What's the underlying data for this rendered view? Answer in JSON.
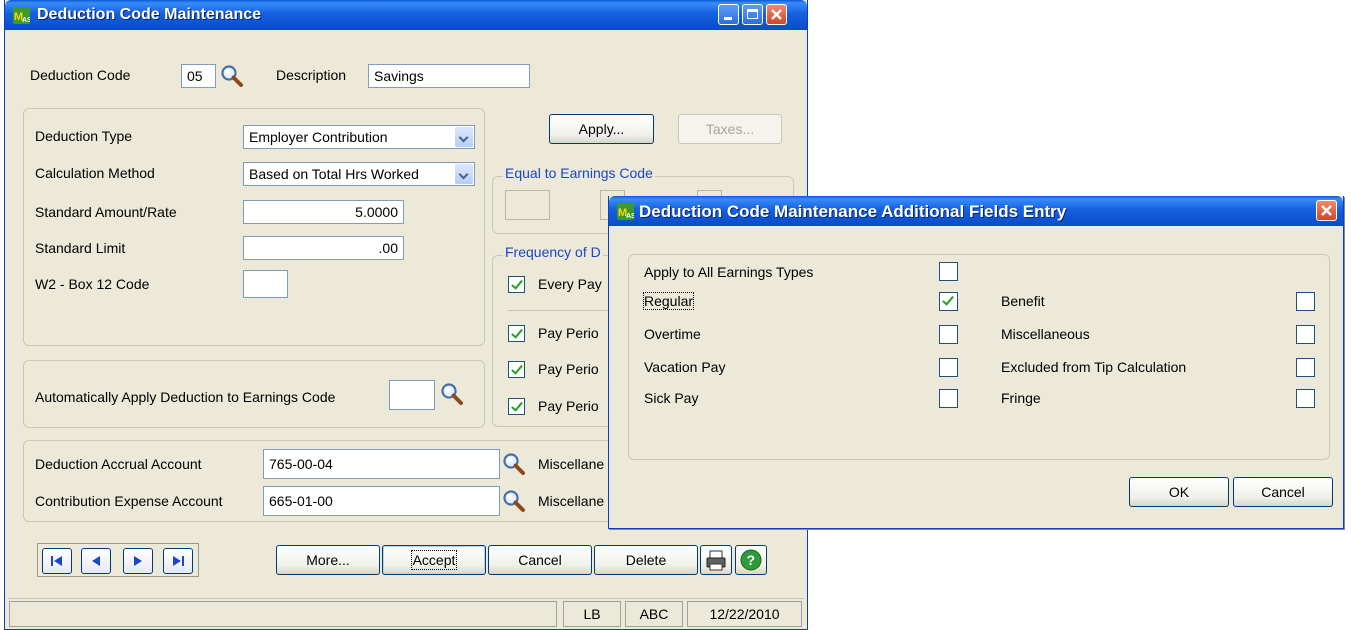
{
  "main": {
    "title": "Deduction Code Maintenance",
    "deduction_code_label": "Deduction Code",
    "deduction_code_value": "05",
    "description_label": "Description",
    "description_value": "Savings",
    "deduction_type_label": "Deduction Type",
    "deduction_type_value": "Employer Contribution",
    "calc_method_label": "Calculation Method",
    "calc_method_value": "Based on Total Hrs Worked",
    "std_amount_label": "Standard Amount/Rate",
    "std_amount_value": "5.0000",
    "std_limit_label": "Standard Limit",
    "std_limit_value": ".00",
    "w2_label": "W2 - Box 12 Code",
    "w2_value": "",
    "apply_label": "Apply...",
    "taxes_label": "Taxes...",
    "equal_group": "Equal to Earnings Code",
    "freq_group": "Frequency of D",
    "every_pay_label": "Every Pay",
    "pay_period_label": "Pay Perio",
    "auto_apply_label": "Automatically Apply Deduction to Earnings Code",
    "accrual_label": "Deduction Accrual Account",
    "accrual_value": "765-00-04",
    "contrib_label": "Contribution Expense Account",
    "contrib_value": "665-01-00",
    "misc_label": "Miscellane",
    "more_label": "More...",
    "accept_label": "Accept",
    "cancel_label": "Cancel",
    "delete_label": "Delete",
    "status": {
      "user": "LB",
      "company": "ABC",
      "date": "12/22/2010"
    },
    "checks": {
      "every_pay": true,
      "pay_period_1": true,
      "pay_period_2": true,
      "pay_period_3": true
    }
  },
  "dialog": {
    "title": "Deduction Code Maintenance Additional Fields Entry",
    "apply_all_label": "Apply to All Earnings Types",
    "left_items": [
      {
        "label": "Regular",
        "checked": true
      },
      {
        "label": "Overtime",
        "checked": false
      },
      {
        "label": "Vacation Pay",
        "checked": false
      },
      {
        "label": "Sick Pay",
        "checked": false
      }
    ],
    "right_items": [
      {
        "label": "Benefit",
        "checked": false
      },
      {
        "label": "Miscellaneous",
        "checked": false
      },
      {
        "label": "Excluded from Tip Calculation",
        "checked": false
      },
      {
        "label": "Fringe",
        "checked": false
      }
    ],
    "ok_label": "OK",
    "cancel_label": "Cancel"
  },
  "icons": [
    "app-icon",
    "magnifier-icon",
    "minimize-icon",
    "maximize-icon",
    "close-icon",
    "first-record-icon",
    "previous-record-icon",
    "next-record-icon",
    "last-record-icon",
    "printer-icon",
    "help-icon"
  ],
  "colors": {
    "title_bar": "#0a4cc8",
    "window_face": "#ece9d8",
    "group_label": "#1a46c8",
    "check_mark": "#21a121",
    "close_button": "#d5452a"
  }
}
